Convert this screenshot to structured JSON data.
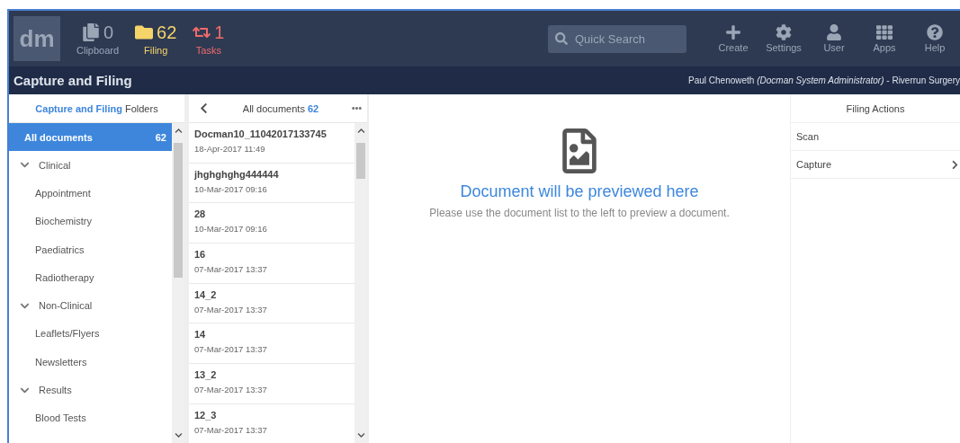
{
  "logo": "dm",
  "counters": [
    {
      "kind": "clipboard",
      "count": "0",
      "label": "Clipboard"
    },
    {
      "kind": "filing",
      "count": "62",
      "label": "Filing"
    },
    {
      "kind": "tasks",
      "count": "1",
      "label": "Tasks"
    }
  ],
  "search": {
    "placeholder": "Quick Search"
  },
  "toolbar": [
    {
      "kind": "create",
      "label": "Create"
    },
    {
      "kind": "settings",
      "label": "Settings"
    },
    {
      "kind": "user",
      "label": "User"
    },
    {
      "kind": "apps",
      "label": "Apps"
    },
    {
      "kind": "help",
      "label": "Help"
    }
  ],
  "page_title": "Capture and Filing",
  "user_line": "Paul Chenoweth *(Docman System Administrator)* - Riverrun Surgery",
  "folders": {
    "title_highlight": "Capture and Filing",
    "title": "Folders",
    "all": {
      "label": "All documents",
      "count": "62",
      "selected": true
    },
    "items": [
      {
        "label": "Clinical",
        "expanded": true,
        "children": [
          {
            "label": "Appointment"
          },
          {
            "label": "Biochemistry"
          },
          {
            "label": "Paediatrics"
          },
          {
            "label": "Radiotherapy"
          }
        ]
      },
      {
        "label": "Non-Clinical",
        "expanded": true,
        "children": [
          {
            "label": "Leaflets/Flyers"
          },
          {
            "label": "Newsletters"
          }
        ]
      },
      {
        "label": "Results",
        "expanded": true,
        "children": [
          {
            "label": "Blood Tests"
          }
        ]
      }
    ]
  },
  "documents": {
    "title": "All documents",
    "count": "62",
    "items": [
      {
        "name": "Docman10_11042017133745",
        "date": "18-Apr-2017 11:49"
      },
      {
        "name": "jhghghghg444444",
        "date": "10-Mar-2017 09:16"
      },
      {
        "name": "28",
        "date": "10-Mar-2017 09:16"
      },
      {
        "name": "16",
        "date": "07-Mar-2017 13:37"
      },
      {
        "name": "14_2",
        "date": "07-Mar-2017 13:37"
      },
      {
        "name": "14",
        "date": "07-Mar-2017 13:37"
      },
      {
        "name": "13_2",
        "date": "07-Mar-2017 13:37"
      },
      {
        "name": "12_3",
        "date": "07-Mar-2017 13:37"
      }
    ]
  },
  "preview": {
    "heading": "Document will be previewed here",
    "text": "Please use the document list to the left to preview a document."
  },
  "actions": {
    "title": "Filing Actions",
    "items": [
      {
        "label": "Scan",
        "has_submenu": false
      },
      {
        "label": "Capture",
        "has_submenu": true
      }
    ]
  }
}
